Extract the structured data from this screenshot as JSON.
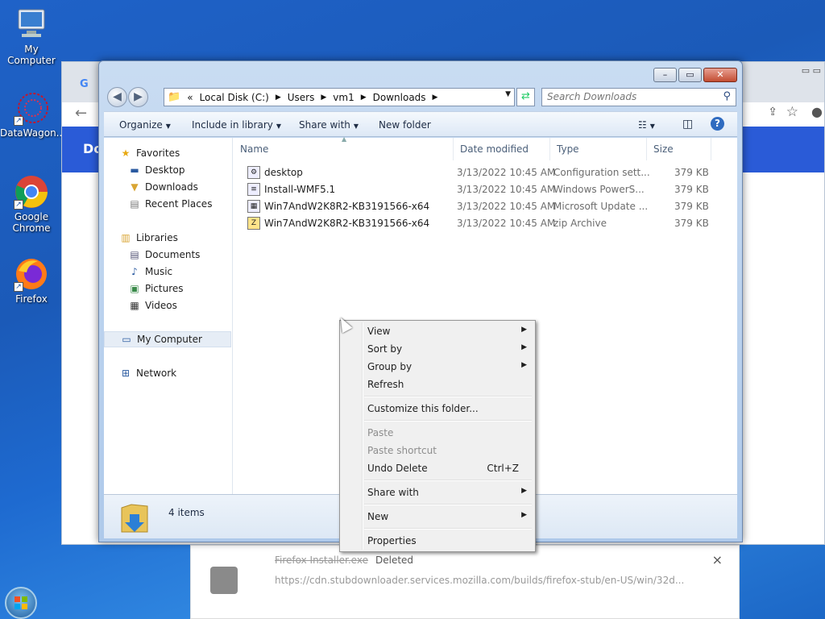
{
  "desktop": {
    "icons": [
      {
        "label": "My Computer",
        "icon": "computer-icon"
      },
      {
        "label": "DataWagon...",
        "icon": "datawagon-icon"
      },
      {
        "label": "Google Chrome",
        "icon": "chrome-icon"
      },
      {
        "label": "Firefox",
        "icon": "firefox-icon"
      }
    ]
  },
  "chrome_bg": {
    "banner_text": "Do",
    "download": {
      "filename": "Firefox Installer.exe",
      "status": "Deleted",
      "url": "https://cdn.stubdownloader.services.mozilla.com/builds/firefox-stub/en-US/win/32d...",
      "close": "×"
    }
  },
  "explorer": {
    "caption": {
      "minimize": "–",
      "maximize": "▭",
      "close": "✕"
    },
    "address": {
      "prefix": "«",
      "crumbs": [
        "Local Disk (C:)",
        "Users",
        "vm1",
        "Downloads"
      ]
    },
    "search_placeholder": "Search Downloads",
    "commands": {
      "organize": "Organize",
      "include": "Include in library",
      "share": "Share with",
      "new_folder": "New folder"
    },
    "nav": {
      "favorites": "Favorites",
      "desktop": "Desktop",
      "downloads": "Downloads",
      "recent": "Recent Places",
      "libraries": "Libraries",
      "documents": "Documents",
      "music": "Music",
      "pictures": "Pictures",
      "videos": "Videos",
      "computer": "My Computer",
      "network": "Network"
    },
    "columns": {
      "name": "Name",
      "date": "Date modified",
      "type": "Type",
      "size": "Size"
    },
    "files": [
      {
        "name": "desktop",
        "date": "3/13/2022 10:45 AM",
        "type": "Configuration sett...",
        "size": "379 KB"
      },
      {
        "name": "Install-WMF5.1",
        "date": "3/13/2022 10:45 AM",
        "type": "Windows PowerS...",
        "size": "379 KB"
      },
      {
        "name": "Win7AndW2K8R2-KB3191566-x64",
        "date": "3/13/2022 10:45 AM",
        "type": "Microsoft Update ...",
        "size": "379 KB"
      },
      {
        "name": "Win7AndW2K8R2-KB3191566-x64",
        "date": "3/13/2022 10:45 AM",
        "type": "zip Archive",
        "size": "379 KB"
      }
    ],
    "status": "4 items"
  },
  "context_menu": {
    "view": "View",
    "sort_by": "Sort by",
    "group_by": "Group by",
    "refresh": "Refresh",
    "customize": "Customize this folder...",
    "paste": "Paste",
    "paste_shortcut": "Paste shortcut",
    "undo_delete": "Undo Delete",
    "undo_shortcut": "Ctrl+Z",
    "share_with": "Share with",
    "new": "New",
    "properties": "Properties"
  }
}
